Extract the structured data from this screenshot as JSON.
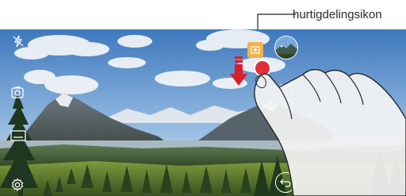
{
  "callout": {
    "label": "hurtigdelingsikon"
  },
  "icons": {
    "flash": "flash-off-icon",
    "timer_settings": "timer-settings-icon",
    "mode": "camera-mode-icon",
    "settings": "gear-icon",
    "quick_share": "quick-share-icon",
    "gallery": "gallery-thumbnail-icon",
    "switch_camera": "switch-camera-icon",
    "back": "back-icon",
    "swipe_arrow": "arrow-down-icon",
    "hand": "hand-gesture-icon"
  },
  "colors": {
    "quick_share_bg": "#f2b34a",
    "shutter_red": "#e0303c",
    "arrow_red": "#d8202c",
    "sky_top": "#4f86c6",
    "sky_low": "#b7d1ea"
  }
}
